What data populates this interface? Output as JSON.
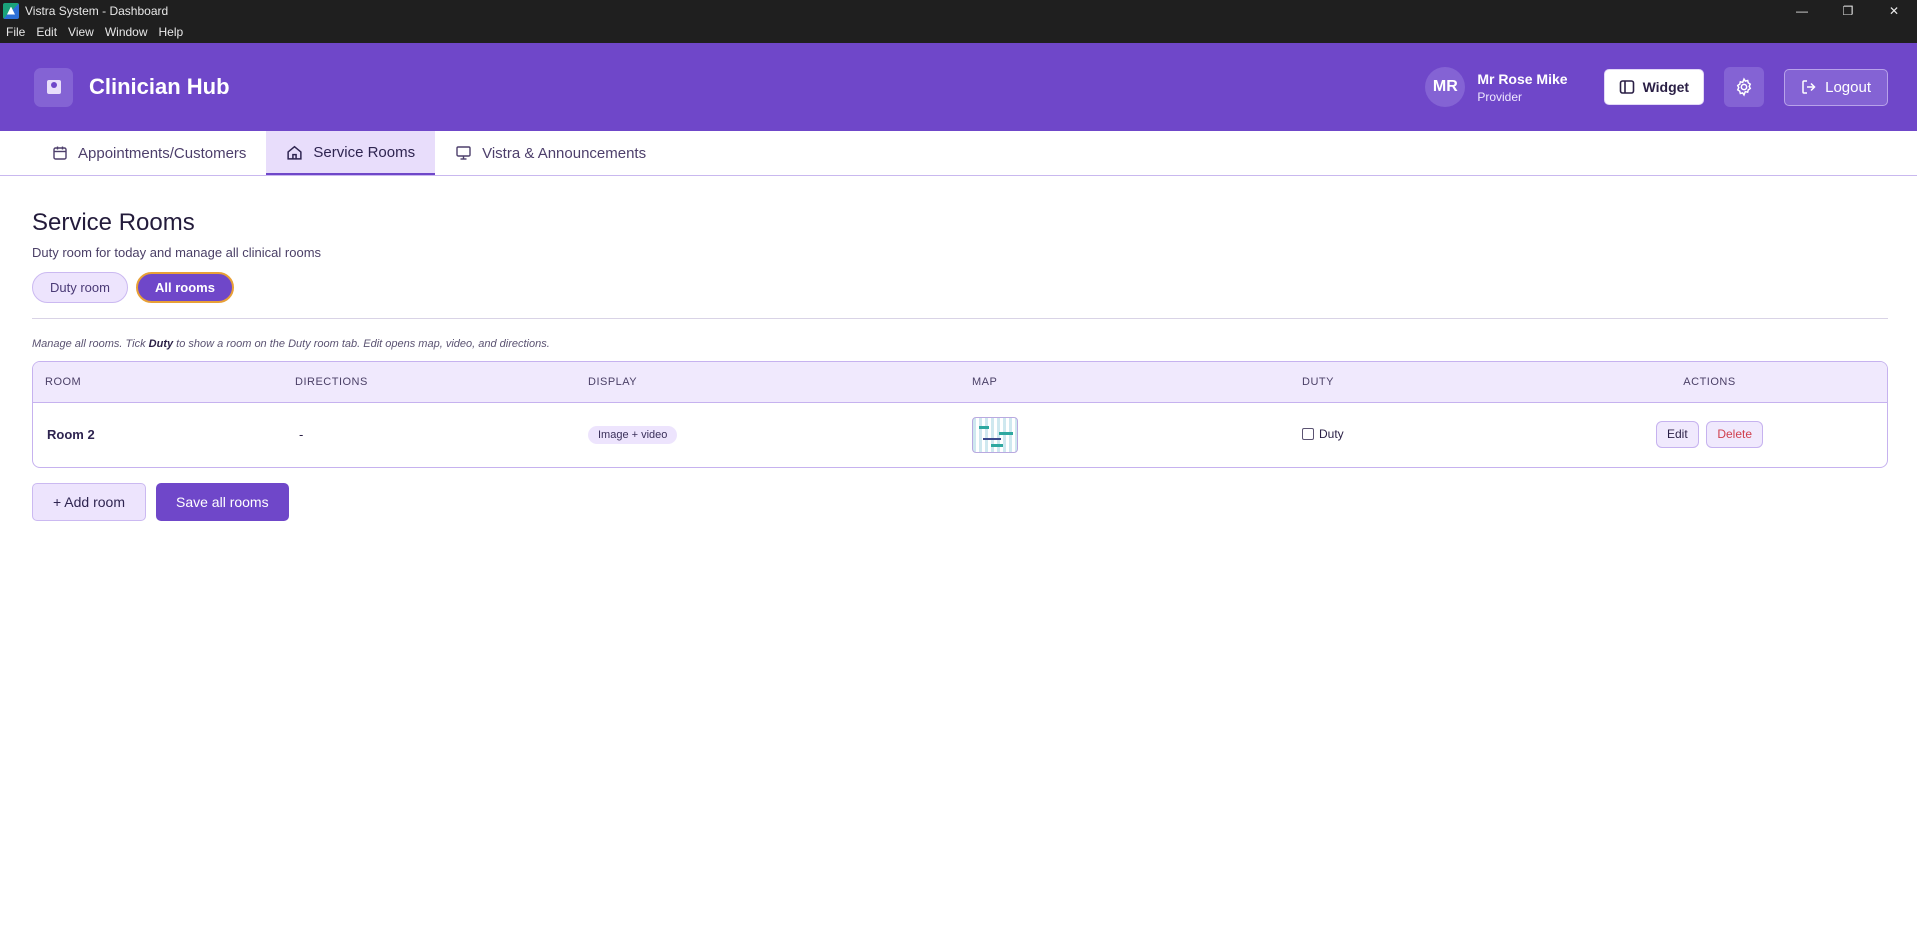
{
  "window": {
    "title": "Vistra System - Dashboard",
    "controls": {
      "minimize": "—",
      "maximize": "❐",
      "close": "✕"
    }
  },
  "menu": [
    "File",
    "Edit",
    "View",
    "Window",
    "Help"
  ],
  "header": {
    "brand": "Clinician Hub",
    "user": {
      "initials": "MR",
      "name": "Mr Rose Mike",
      "role": "Provider"
    },
    "widget_label": "Widget",
    "logout_label": "Logout"
  },
  "tabs": [
    {
      "label": "Appointments/Customers",
      "icon": "calendar-icon",
      "active": false
    },
    {
      "label": "Service Rooms",
      "icon": "home-icon",
      "active": true
    },
    {
      "label": "Vistra & Announcements",
      "icon": "monitor-icon",
      "active": false
    }
  ],
  "page": {
    "title": "Service Rooms",
    "subtitle": "Duty room for today and manage all clinical rooms",
    "pills": [
      {
        "label": "Duty room",
        "active": false
      },
      {
        "label": "All rooms",
        "active": true
      }
    ],
    "hint_prefix": "Manage all rooms. Tick ",
    "hint_bold": "Duty",
    "hint_suffix": " to show a room on the Duty room tab. Edit opens map, video, and directions."
  },
  "table": {
    "columns": [
      "ROOM",
      "DIRECTIONS",
      "DISPLAY",
      "MAP",
      "DUTY",
      "ACTIONS"
    ],
    "rows": [
      {
        "room": "Room 2",
        "directions": "-",
        "display": "Image + video",
        "duty_label": "Duty",
        "duty_checked": false,
        "edit_label": "Edit",
        "delete_label": "Delete"
      }
    ]
  },
  "footer_buttons": {
    "add_label": "+ Add room",
    "save_label": "Save all rooms"
  },
  "colors": {
    "accent": "#6f47c9",
    "accent_light": "#ede4fd",
    "danger": "#d0404e",
    "focus_ring": "#e8a036"
  }
}
